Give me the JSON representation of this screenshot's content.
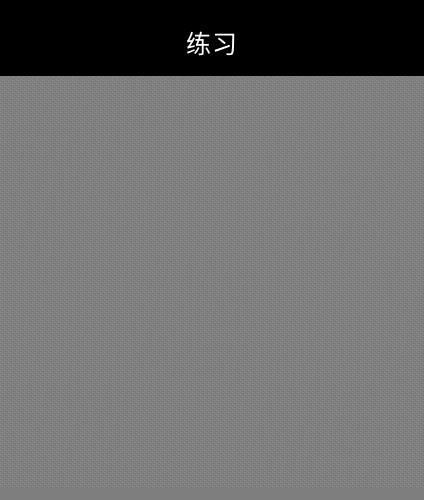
{
  "header": {
    "title": "练习"
  },
  "colors": {
    "header_background": "#000000",
    "header_text": "#ffffff",
    "stimulus_gray": "#808080",
    "bottom_strip": "#7d7d7d"
  }
}
